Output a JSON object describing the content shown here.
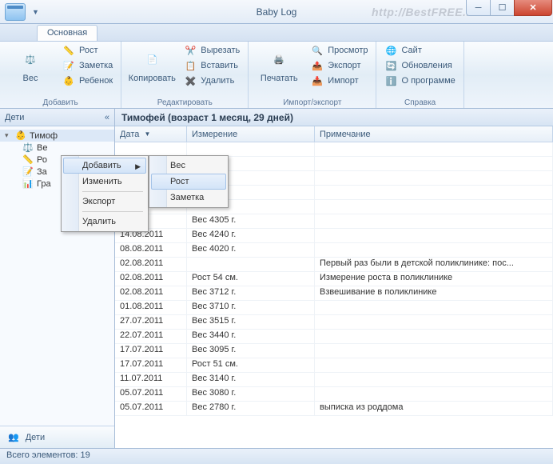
{
  "title": "Baby Log",
  "watermark": "http://BestFREE.ru",
  "ribbon": {
    "tab": "Основная",
    "g1": {
      "label": "Добавить",
      "weight": "Вес",
      "height": "Рост",
      "note": "Заметка",
      "child": "Ребенок"
    },
    "g2": {
      "label": "Редактировать",
      "copy": "Копировать",
      "cut": "Вырезать",
      "paste": "Вставить",
      "delete": "Удалить"
    },
    "g3": {
      "label": "Импорт/экспорт",
      "print": "Печатать",
      "preview": "Просмотр",
      "export": "Экспорт",
      "import": "Импорт"
    },
    "g4": {
      "label": "Справка",
      "site": "Сайт",
      "updates": "Обновления",
      "about": "О программе"
    }
  },
  "sidebar": {
    "header": "Дети",
    "root": "Тимоф",
    "children": [
      "Ве",
      "Ро",
      "За",
      "Гра"
    ],
    "bottom": "Дети"
  },
  "main": {
    "header": "Тимофей (возраст 1 месяц, 29 дней)",
    "cols": {
      "date": "Дата",
      "measure": "Измерение",
      "note": "Примечание"
    },
    "rows": [
      {
        "d": "",
        "m": "",
        "n": ""
      },
      {
        "d": "",
        "m": "",
        "n": ""
      },
      {
        "d": "",
        "m": "",
        "n": ""
      },
      {
        "d": "",
        "m": "",
        "n": ""
      },
      {
        "d": "",
        "m": "",
        "n": ""
      },
      {
        "d": "..2011",
        "m": "Вес 4305 г.",
        "n": ""
      },
      {
        "d": "14.08.2011",
        "m": "Вес 4240 г.",
        "n": ""
      },
      {
        "d": "08.08.2011",
        "m": "Вес 4020 г.",
        "n": ""
      },
      {
        "d": "02.08.2011",
        "m": "",
        "n": "Первый раз были в детской поликлинике: пос..."
      },
      {
        "d": "02.08.2011",
        "m": "Рост 54 см.",
        "n": "Измерение роста в поликлинике"
      },
      {
        "d": "02.08.2011",
        "m": "Вес 3712 г.",
        "n": "Взвешивание в поликлинике"
      },
      {
        "d": "01.08.2011",
        "m": "Вес 3710 г.",
        "n": ""
      },
      {
        "d": "27.07.2011",
        "m": "Вес 3515 г.",
        "n": ""
      },
      {
        "d": "22.07.2011",
        "m": "Вес 3440 г.",
        "n": ""
      },
      {
        "d": "17.07.2011",
        "m": "Вес 3095 г.",
        "n": ""
      },
      {
        "d": "17.07.2011",
        "m": "Рост 51 см.",
        "n": ""
      },
      {
        "d": "11.07.2011",
        "m": "Вес 3140 г.",
        "n": ""
      },
      {
        "d": "05.07.2011",
        "m": "Вес 3080 г.",
        "n": ""
      },
      {
        "d": "05.07.2011",
        "m": "Вес 2780 г.",
        "n": "выписка из роддома"
      }
    ]
  },
  "context1": {
    "add": "Добавить",
    "edit": "Изменить",
    "export": "Экспорт",
    "delete": "Удалить"
  },
  "context2": {
    "weight": "Вес",
    "height": "Рост",
    "note": "Заметка"
  },
  "status": "Всего элементов: 19"
}
